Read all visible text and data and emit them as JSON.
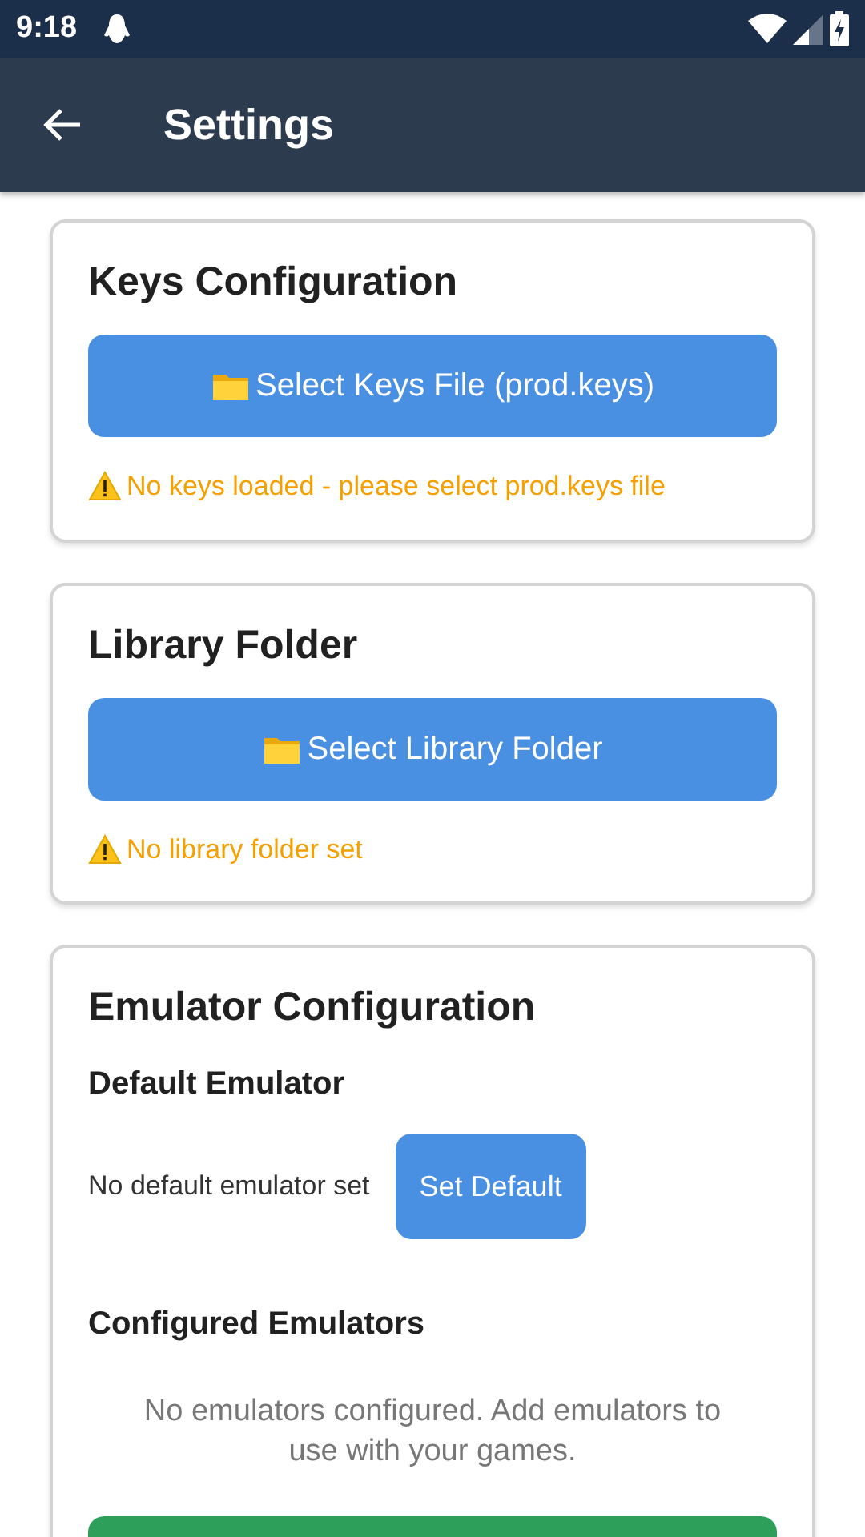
{
  "status_bar": {
    "time": "9:18"
  },
  "app_bar": {
    "title": "Settings"
  },
  "sections": [
    {
      "kind": "file",
      "title": "Keys Configuration",
      "button": "Select Keys File (prod.keys)",
      "warning": "No keys loaded - please select prod.keys file"
    },
    {
      "kind": "file",
      "title": "Library Folder",
      "button": "Select Library Folder",
      "warning": "No library folder set"
    },
    {
      "kind": "emulators",
      "title": "Emulator Configuration",
      "default_heading": "Default Emulator",
      "default_value": "No default emulator set",
      "default_button": "Set Default",
      "configured_heading": "Configured Emulators",
      "empty_message": "No emulators configured. Add emulators to use with your games."
    }
  ]
}
